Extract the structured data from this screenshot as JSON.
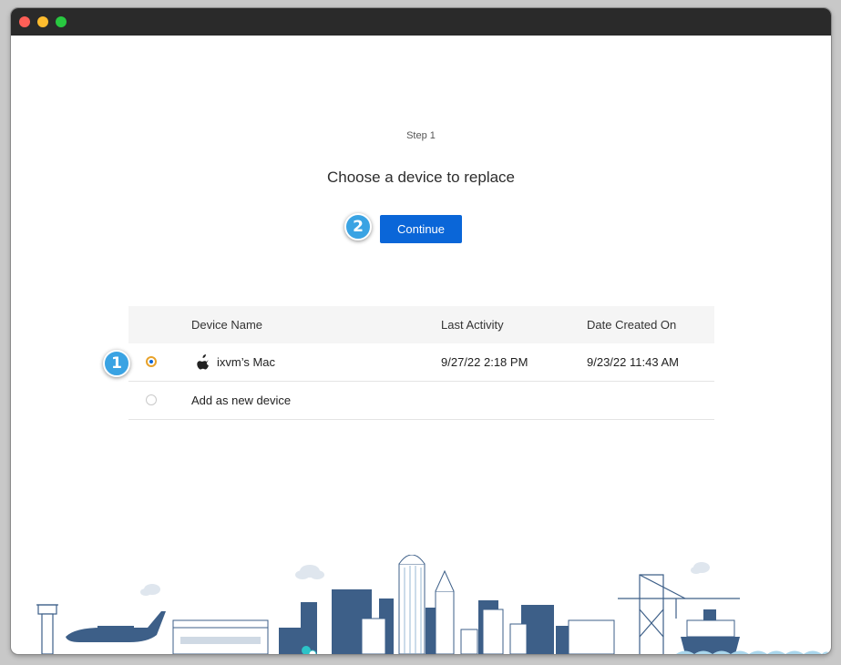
{
  "step": {
    "label": "Step 1"
  },
  "heading": "Choose a device to replace",
  "continue_button": {
    "label": "Continue"
  },
  "markers": {
    "first": "1",
    "second": "2"
  },
  "table": {
    "columns": [
      "Device Name",
      "Last Activity",
      "Date Created On"
    ],
    "rows": [
      {
        "device_name": "ixvm’s Mac",
        "last_activity": "9/27/22 2:18 PM",
        "date_created": "9/23/22 11:43 AM",
        "selected": true,
        "icon": "apple-icon"
      },
      {
        "device_name": "Add as new device",
        "last_activity": "",
        "date_created": "",
        "selected": false
      }
    ]
  },
  "colors": {
    "accent": "#0a66d8",
    "radio_ring": "#e8a22a",
    "marker": "#3aa3e3",
    "skyline": "#3d5f88"
  }
}
